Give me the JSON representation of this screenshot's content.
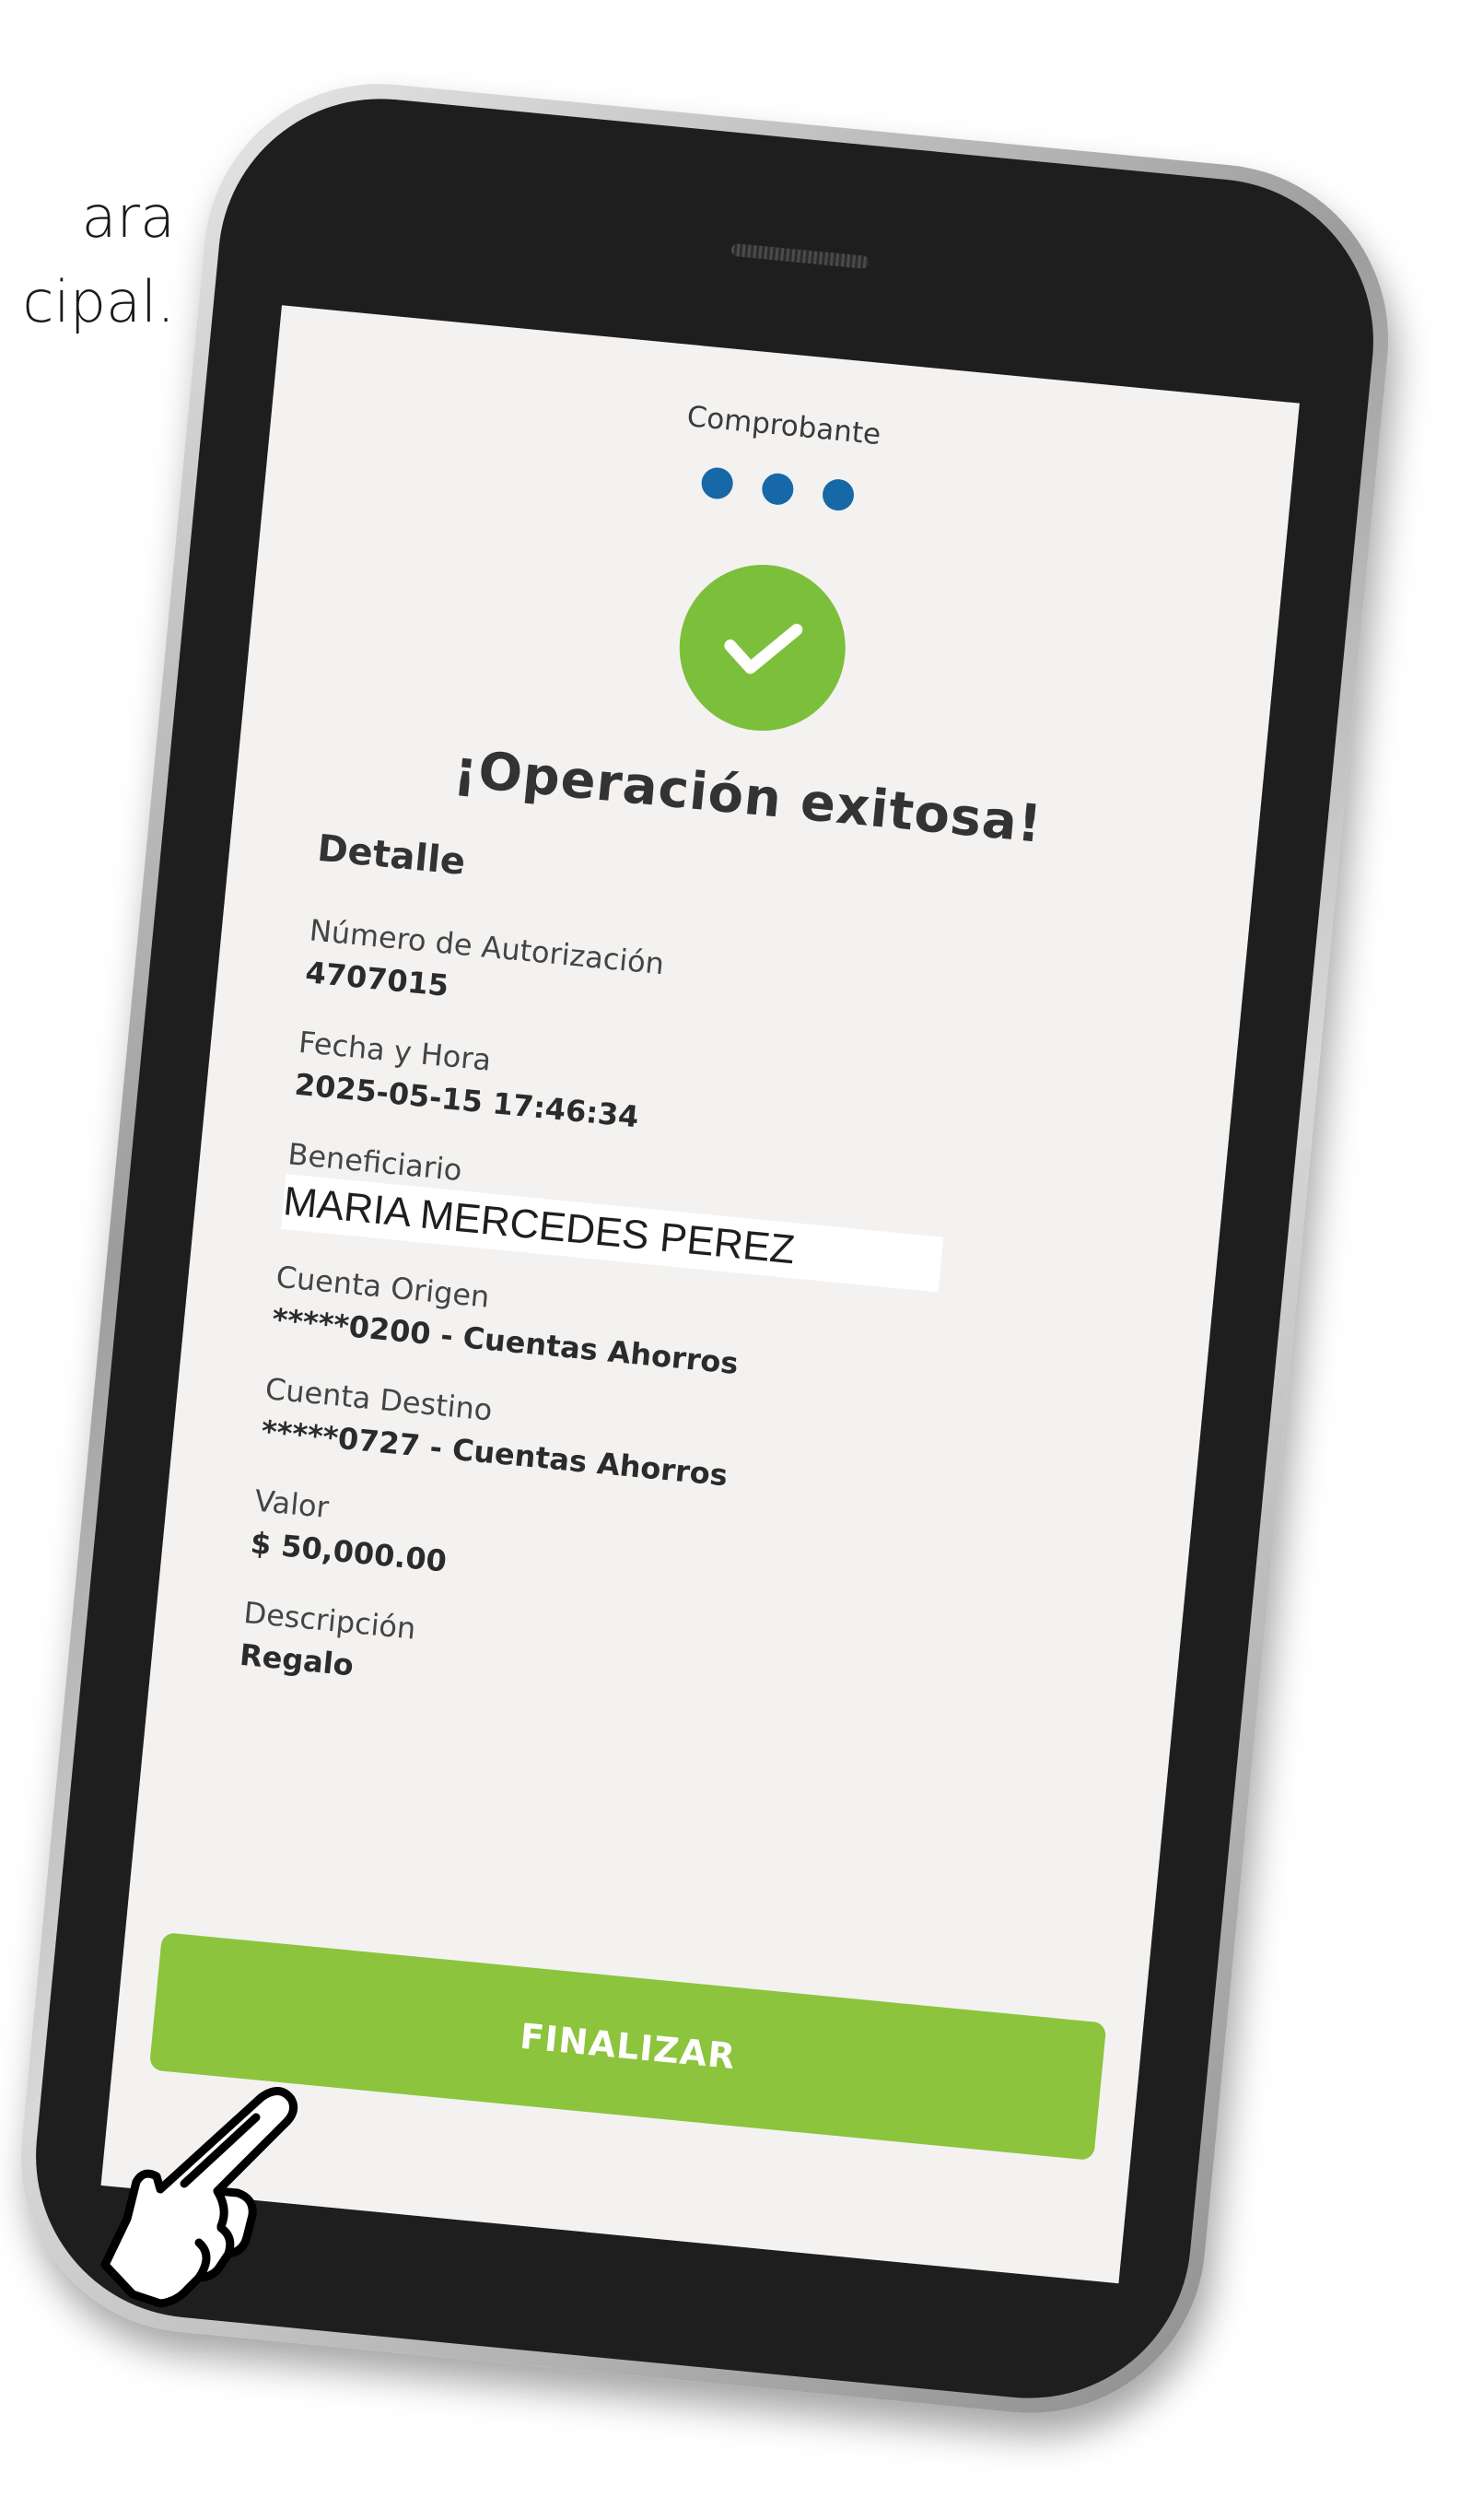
{
  "instruction": {
    "line1": "ara",
    "line2": "cipal."
  },
  "screen": {
    "title": "Comprobante",
    "steps": 3,
    "success_message": "¡Operación exitosa!",
    "detail_heading": "Detalle",
    "fields": {
      "authorization": {
        "label": "Número de Autorización",
        "value": "4707015"
      },
      "datetime": {
        "label": "Fecha y Hora",
        "value": "2025-05-15 17:46:34"
      },
      "beneficiary": {
        "label": "Beneficiario",
        "value": "MARIA MERCEDES PEREZ"
      },
      "origin_account": {
        "label": "Cuenta Origen",
        "value": "*****0200 - Cuentas Ahorros"
      },
      "destination_account": {
        "label": "Cuenta Destino",
        "value": "*****0727 - Cuentas Ahorros"
      },
      "amount": {
        "label": "Valor",
        "value": "$ 50,000.00"
      },
      "description": {
        "label": "Descripción",
        "value": "Regalo"
      }
    },
    "finish_button": "FINALIZAR"
  },
  "colors": {
    "accent_green": "#8cc43d",
    "success_green": "#7cbf3b",
    "step_blue": "#1668a7",
    "screen_bg": "#f3f2f1",
    "phone_body": "#1e1e1e"
  },
  "icons": {
    "success": "check-circle-icon",
    "pointer": "pointing-hand-icon"
  }
}
